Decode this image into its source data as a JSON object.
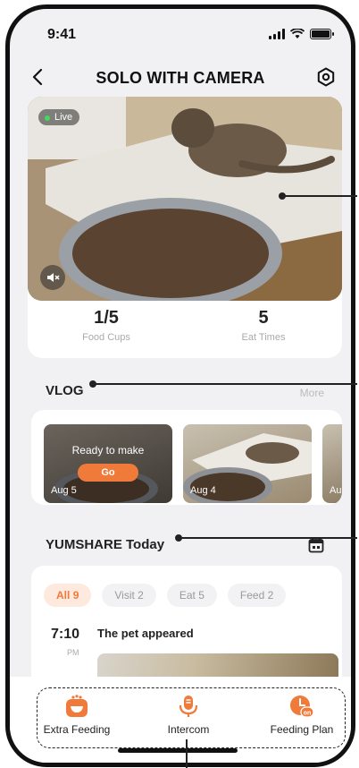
{
  "status_bar": {
    "time": "9:41"
  },
  "header": {
    "title": "SOLO WITH CAMERA"
  },
  "camera": {
    "live_label": "Live"
  },
  "stats": [
    {
      "value": "1/5",
      "label": "Food Cups"
    },
    {
      "value": "5",
      "label": "Eat Times"
    }
  ],
  "vlog": {
    "title": "VLOG",
    "more_label": "More",
    "items": [
      {
        "date": "Aug 5",
        "prompt": "Ready to make",
        "action": "Go"
      },
      {
        "date": "Aug 4"
      },
      {
        "date": "Aug"
      }
    ]
  },
  "today": {
    "title": "YUMSHARE Today",
    "filters": [
      {
        "label": "All",
        "count": "9",
        "active": true
      },
      {
        "label": "Visit",
        "count": "2",
        "active": false
      },
      {
        "label": "Eat",
        "count": "5",
        "active": false
      },
      {
        "label": "Feed",
        "count": "2",
        "active": false
      }
    ],
    "event": {
      "time": "7:10",
      "ampm": "PM",
      "text": "The pet appeared"
    }
  },
  "bottom_actions": [
    {
      "label": "Extra Feeding",
      "icon": "food-bowl-icon"
    },
    {
      "label": "Intercom",
      "icon": "microphone-icon"
    },
    {
      "label": "Feeding Plan",
      "icon": "clock-on-icon"
    }
  ],
  "colors": {
    "accent": "#f07a3a",
    "accent_light": "#fde9dd",
    "live": "#3ddc5a"
  }
}
